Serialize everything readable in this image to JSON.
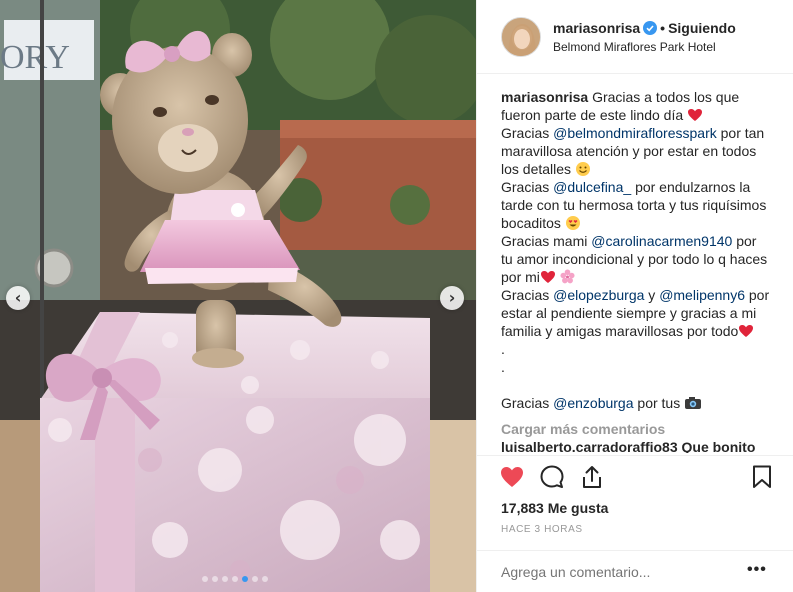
{
  "post": {
    "carousel": {
      "slide_count": 7,
      "active_slide": 5
    },
    "photo_sign_text": "ORY"
  },
  "header": {
    "username": "mariasonrisa",
    "separator": "•",
    "follow_status": "Siguiendo",
    "location": "Belmond Miraflores Park Hotel",
    "verified": true
  },
  "caption": {
    "username": "mariasonrisa",
    "lines": {
      "l1": "Gracias a todos los que fueron parte de este lindo día",
      "l2a": "Gracias",
      "l2m": "@belmondmirafloresspark",
      "l2b": "por tan maravillosa atención y por estar en todos los detalles",
      "l3a": "Gracias",
      "l3m": "@dulcefina_",
      "l3b": "por endulzarnos la tarde con tu hermosa torta y tus riquísimos bocaditos",
      "l4a": "Gracias mami",
      "l4m": "@carolinacarmen9140",
      "l4b": "por tu amor incondicional y por todo lo q haces por mi",
      "l5a": "Gracias",
      "l5m1": "@elopezburga",
      "l5y": "y",
      "l5m2": "@melipenny6",
      "l5b": "por estar al pendiente siempre y gracias a mi familia y amigas maravillosas por todo",
      "dot1": ".",
      "dot2": ".",
      "l6a": "Gracias",
      "l6m": "@enzoburga",
      "l6b": "por tus"
    }
  },
  "load_more": "Cargar más comentarios",
  "next_comment_partial": "luisalberto.carradoraffio83 Que bonito",
  "likes": "17,883 Me gusta",
  "timestamp": "HACE 3 HORAS",
  "comment_input": {
    "placeholder": "Agrega un comentario..."
  },
  "more_label": "•••",
  "icons": [
    "verified-badge-icon",
    "heart-icon",
    "comment-icon",
    "share-icon",
    "bookmark-icon",
    "chevron-left-icon",
    "chevron-right-icon"
  ],
  "colors": {
    "like": "#ed4956",
    "mention": "#003569",
    "verified": "#3897f0",
    "muted": "#999999"
  }
}
